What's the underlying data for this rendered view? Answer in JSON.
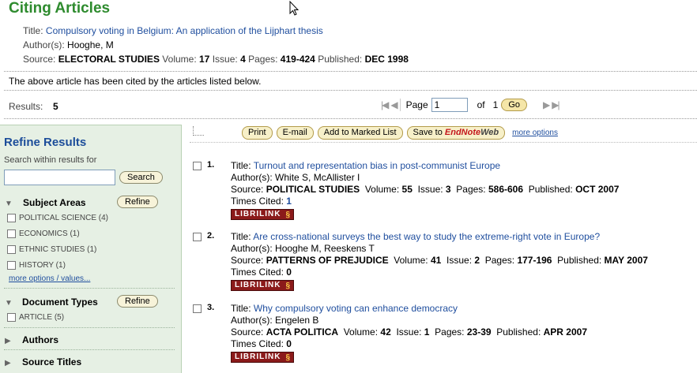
{
  "header": {
    "page_title": "Citing Articles",
    "title_label": "Title:",
    "title_value": "Compulsory voting in Belgium: An application of the Lijphart thesis",
    "authors_label": "Author(s):",
    "authors_value": "Hooghe, M",
    "source_label": "Source:",
    "source_value": "ELECTORAL STUDIES",
    "volume_label": "Volume:",
    "volume_value": "17",
    "issue_label": "Issue:",
    "issue_value": "4",
    "pages_label": "Pages:",
    "pages_value": "419-424",
    "published_label": "Published:",
    "published_value": "DEC 1998"
  },
  "cited_note": "The above article has been cited by the articles listed below.",
  "results": {
    "label": "Results:",
    "count": "5"
  },
  "pager": {
    "page_label": "Page",
    "page_value": "1",
    "of_label": "of",
    "total": "1",
    "go_label": "Go"
  },
  "toolbar": {
    "print": "Print",
    "email": "E-mail",
    "add_marked": "Add to Marked List",
    "save_to": "Save to",
    "endnote": "EndNote",
    "web": "Web",
    "more_options": "more options"
  },
  "sidebar": {
    "title": "Refine Results",
    "search_label": "Search within results for",
    "search_button": "Search",
    "subject_areas": "Subject Areas",
    "refine_label": "Refine",
    "subjects": [
      "POLITICAL SCIENCE (4)",
      "ECONOMICS (1)",
      "ETHNIC STUDIES (1)",
      "HISTORY (1)"
    ],
    "more_values": "more options / values...",
    "document_types": "Document Types",
    "doc_types": [
      "ARTICLE (5)"
    ],
    "authors": "Authors",
    "source_titles": "Source Titles"
  },
  "record_labels": {
    "title": "Title:",
    "authors": "Author(s):",
    "source": "Source:",
    "volume": "Volume:",
    "issue": "Issue:",
    "pages": "Pages:",
    "published": "Published:",
    "times_cited": "Times Cited:",
    "librilink": "LIBRILINK"
  },
  "records": [
    {
      "num": "1.",
      "title": "Turnout and representation bias in post-communist Europe",
      "authors": "White S, McAllister I",
      "source": "POLITICAL STUDIES",
      "volume": "55",
      "issue": "3",
      "pages": "586-606",
      "published": "OCT 2007",
      "times_cited": "1"
    },
    {
      "num": "2.",
      "title": "Are cross-national surveys the best way to study the extreme-right vote in Europe?",
      "authors": "Hooghe M, Reeskens T",
      "source": "PATTERNS OF PREJUDICE",
      "volume": "41",
      "issue": "2",
      "pages": "177-196",
      "published": "MAY 2007",
      "times_cited": "0"
    },
    {
      "num": "3.",
      "title": "Why compulsory voting can enhance democracy",
      "authors": "Engelen B",
      "source": "ACTA POLITICA",
      "volume": "42",
      "issue": "1",
      "pages": "23-39",
      "published": "APR 2007",
      "times_cited": "0"
    }
  ]
}
